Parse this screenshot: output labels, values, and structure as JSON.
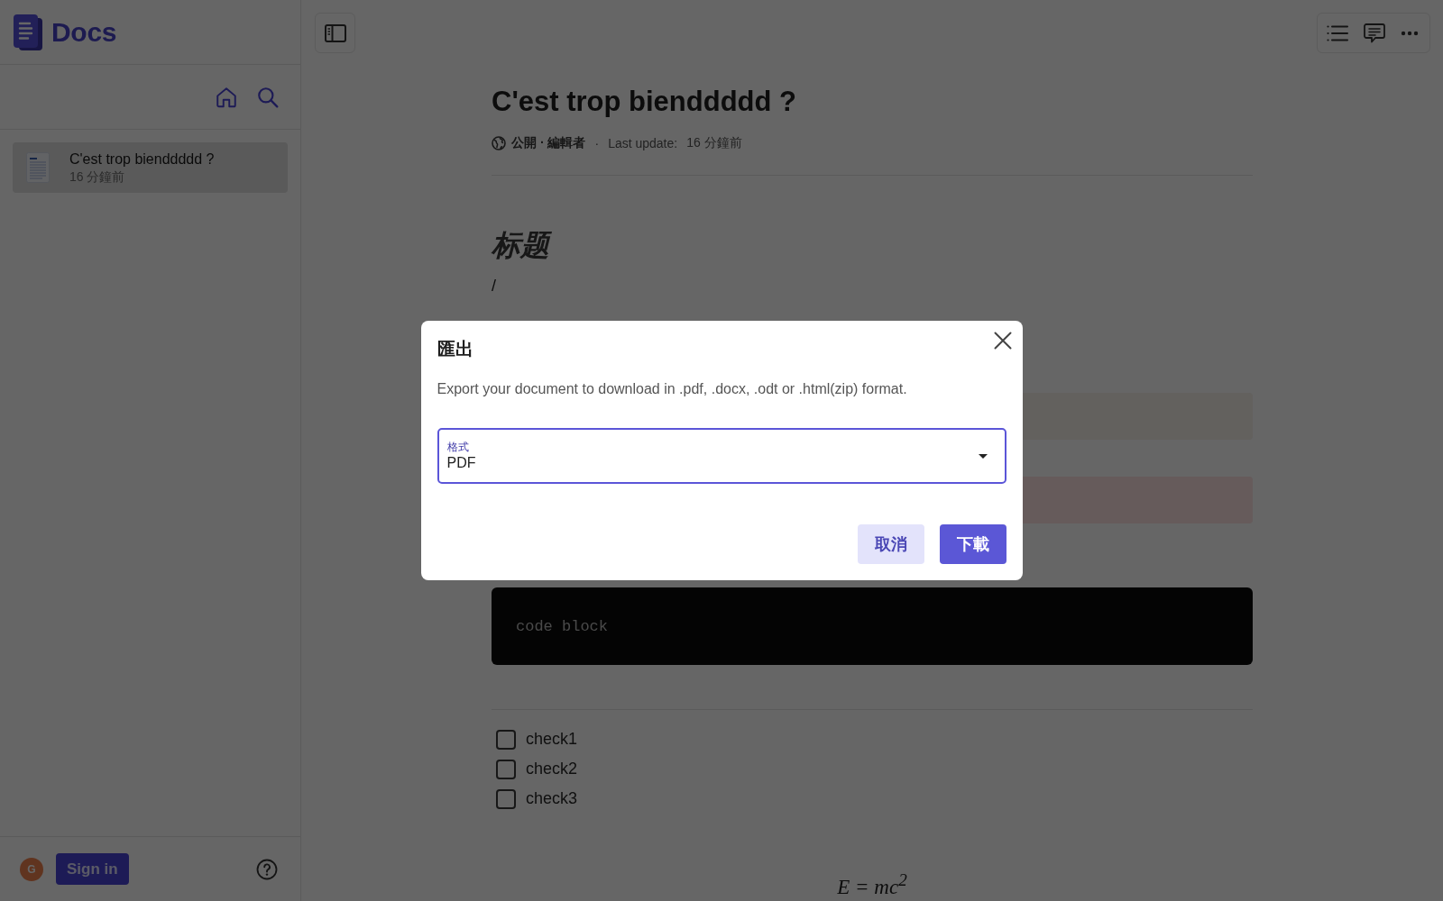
{
  "app": {
    "logo_text": "Docs"
  },
  "sidebar": {
    "documents": [
      {
        "title": "C'est trop bienddddd ?",
        "updated": "16 分鐘前",
        "selected": true
      }
    ],
    "footer": {
      "avatar_initial": "G",
      "sign_in": "Sign in"
    }
  },
  "document": {
    "title": "C'est trop bienddddd ?",
    "visibility": "公開 · 編輯者",
    "separator": "·",
    "last_update_label": "Last update:",
    "last_update": "16 分鐘前",
    "blocks": [
      {
        "kind": "heading",
        "text": "标题"
      },
      {
        "kind": "paragraph",
        "text": "/"
      },
      {
        "kind": "shaded",
        "color": "#63615e"
      },
      {
        "kind": "shaded",
        "color": "#665b5b"
      },
      {
        "kind": "code",
        "text": "code block"
      },
      {
        "kind": "divider"
      },
      {
        "kind": "checklist",
        "items": [
          {
            "label": "check1",
            "checked": false
          },
          {
            "label": "check2",
            "checked": false
          },
          {
            "label": "check3",
            "checked": false
          }
        ]
      },
      {
        "kind": "math",
        "text": "E = mc$^{2}$"
      }
    ]
  },
  "dialog": {
    "title": "匯出",
    "description": "Export your document to download in .pdf, .docx, .odt or .html(zip) format.",
    "format_field": {
      "label": "格式",
      "value": "PDF"
    },
    "buttons": [
      {
        "label": "取消",
        "kind": "secondary"
      },
      {
        "label": "下載",
        "kind": "primary"
      }
    ]
  }
}
